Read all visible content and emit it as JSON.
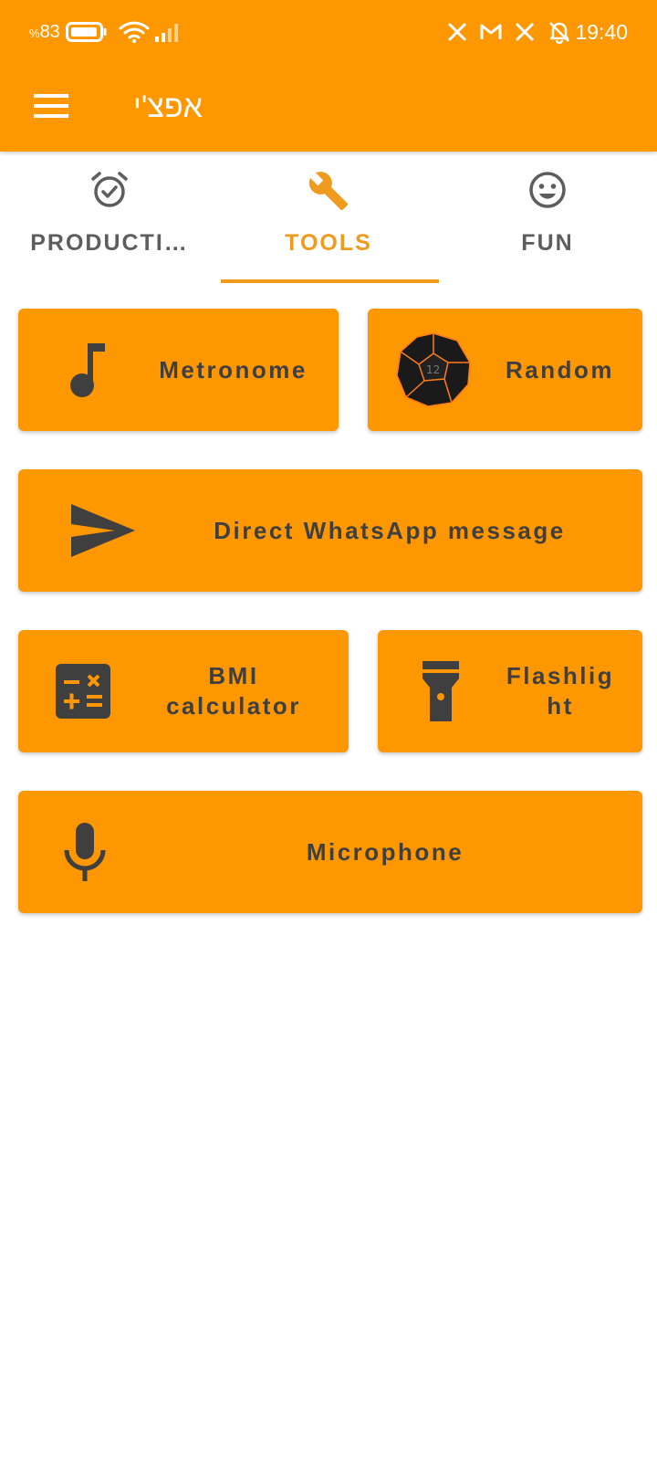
{
  "status_bar": {
    "battery_percent": "83",
    "percent_sign": "%",
    "time": "19:40"
  },
  "app_bar": {
    "title": "אפצ'י",
    "menu_icon": "hamburger-menu-icon"
  },
  "tabs": [
    {
      "label": "PRODUCTI…",
      "icon": "alarm-check-icon",
      "active": false
    },
    {
      "label": "TOOLS",
      "icon": "wrench-icon",
      "active": true
    },
    {
      "label": "FUN",
      "icon": "smiley-icon",
      "active": false
    }
  ],
  "tools": {
    "metronome": "Metronome",
    "random": "Random",
    "whatsapp": "Direct WhatsApp message",
    "bmi_line1": "BMI",
    "bmi_line2": "calculator",
    "flashlight_line1": "Flashlig",
    "flashlight_line2": "ht",
    "microphone": "Microphone"
  },
  "dice_text": "12",
  "colors": {
    "primary": "#FF9700",
    "tab_active": "#EE9B1E",
    "tab_inactive": "#5d5d5d",
    "card_text": "#3f3f3f",
    "icon_dark": "#3f3f3f"
  }
}
